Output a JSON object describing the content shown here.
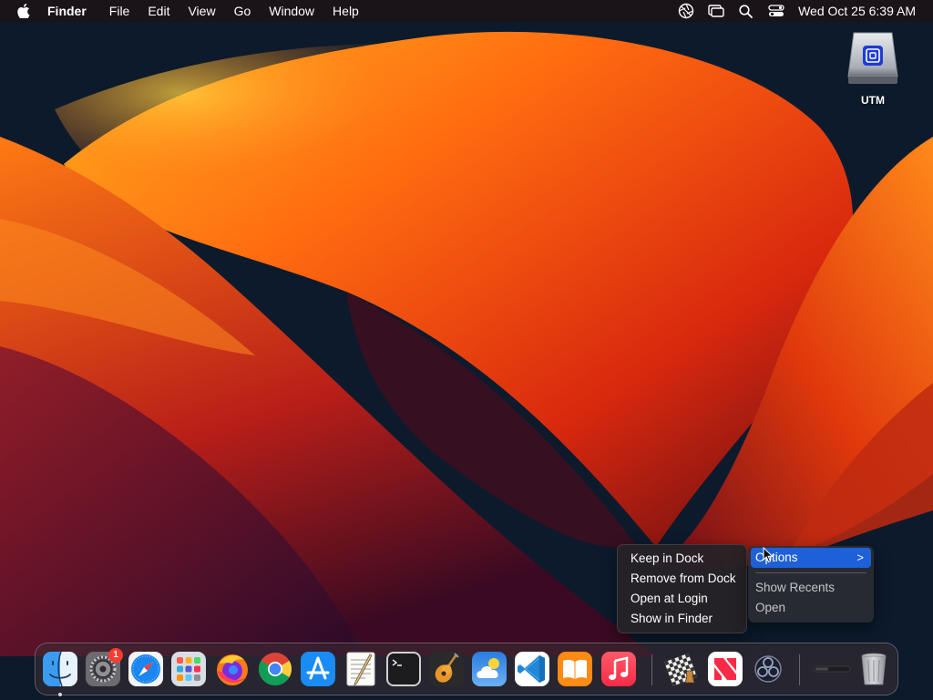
{
  "menubar": {
    "apple_icon": "apple-logo-icon",
    "app_name": "Finder",
    "menus": [
      "File",
      "Edit",
      "View",
      "Go",
      "Window",
      "Help"
    ],
    "status_icons": [
      "aperture-icon",
      "screen-mirroring-icon",
      "search-icon",
      "control-center-icon"
    ],
    "clock": "Wed Oct 25  6:39 AM"
  },
  "desktop": {
    "icons": [
      {
        "label": "UTM",
        "icon": "external-drive-icon"
      }
    ]
  },
  "context_menu": {
    "items": [
      "Keep in Dock",
      "Remove from Dock",
      "Open at Login",
      "Show in Finder"
    ]
  },
  "submenu": {
    "options_label": "Options",
    "chevron": ">",
    "show_recents": "Show Recents",
    "open": "Open"
  },
  "dock": {
    "apps": [
      {
        "name": "Finder",
        "icon": "finder-icon",
        "running": true
      },
      {
        "name": "System Settings",
        "icon": "settings-gear-icon",
        "badge": "1"
      },
      {
        "name": "Safari",
        "icon": "safari-compass-icon"
      },
      {
        "name": "Launchpad",
        "icon": "launchpad-grid-icon"
      },
      {
        "name": "Firefox",
        "icon": "firefox-icon"
      },
      {
        "name": "Chrome",
        "icon": "chrome-icon"
      },
      {
        "name": "App Store",
        "icon": "app-store-icon"
      },
      {
        "name": "TextEdit",
        "icon": "textedit-icon"
      },
      {
        "name": "Terminal",
        "icon": "terminal-icon"
      },
      {
        "name": "GarageBand",
        "icon": "guitar-icon"
      },
      {
        "name": "Weather",
        "icon": "weather-cloud-icon"
      },
      {
        "name": "VS Code",
        "icon": "vscode-icon"
      },
      {
        "name": "Books",
        "icon": "books-icon"
      },
      {
        "name": "Music",
        "icon": "music-note-icon"
      },
      {
        "name": "Chess",
        "icon": "chess-icon"
      },
      {
        "name": "News",
        "icon": "news-icon"
      },
      {
        "name": "OBS",
        "icon": "obs-icon"
      },
      {
        "name": "Minimized window",
        "icon": "minimized-window-icon"
      },
      {
        "name": "Trash",
        "icon": "trash-icon"
      }
    ]
  },
  "colors": {
    "menu_highlight": "#1d60d8",
    "badge": "#ff3b30"
  }
}
